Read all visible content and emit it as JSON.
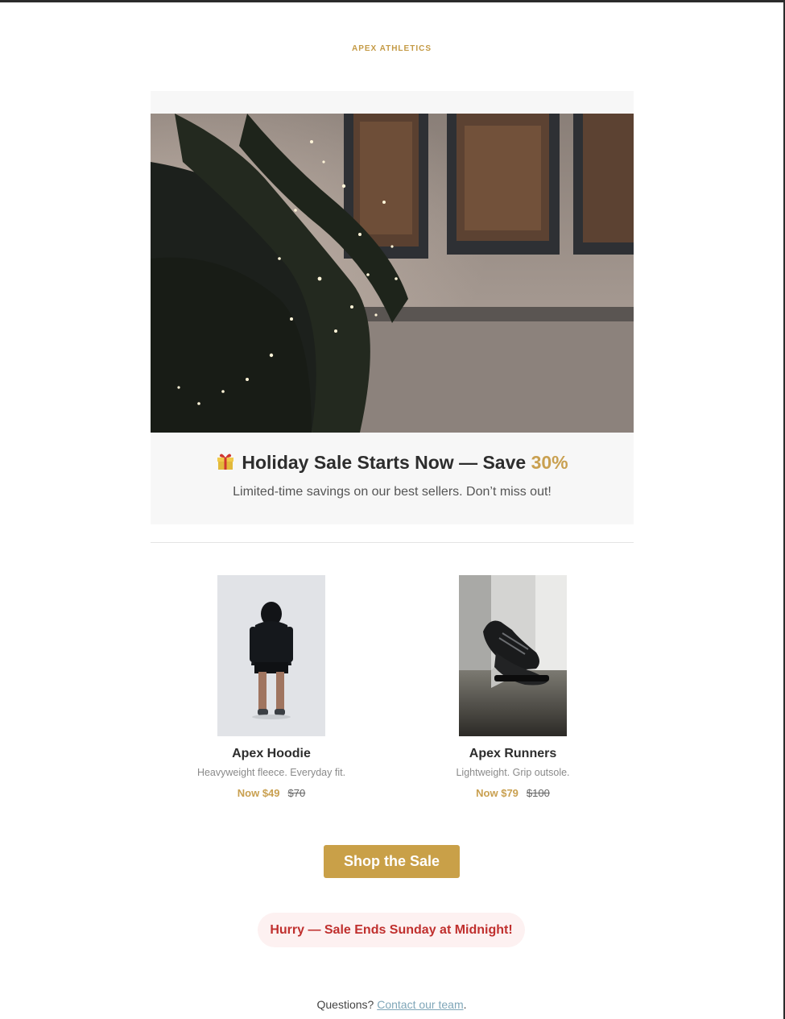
{
  "brand": {
    "name": "APEX ATHLETICS"
  },
  "hero": {
    "image_icon": "holiday-garland-photo",
    "title_prefix": "Holiday Sale Starts Now — Save ",
    "title_highlight": "30%",
    "gift_icon": "gift-icon",
    "subtitle": "Limited-time savings on our best sellers. Don’t miss out!"
  },
  "products": [
    {
      "name": "Apex Hoodie",
      "description": "Heavyweight fleece. Everyday fit.",
      "now_price": "Now $49",
      "was_price": "$70",
      "image_icon": "hoodie-model-photo"
    },
    {
      "name": "Apex Runners",
      "description": "Lightweight. Grip outsole.",
      "now_price": "Now $79",
      "was_price": "$100",
      "image_icon": "running-shoes-photo"
    }
  ],
  "cta": {
    "label": "Shop the Sale"
  },
  "urgency": {
    "text": "Hurry — Sale Ends Sunday at Midnight!"
  },
  "footer": {
    "question": "Questions? ",
    "link_text": "Contact our team",
    "suffix": "."
  },
  "colors": {
    "accent_gold": "#c9a048",
    "urgency_red": "#c0302e",
    "urgency_bg": "#fdf1f1",
    "link_blue": "#7fa6b8"
  }
}
